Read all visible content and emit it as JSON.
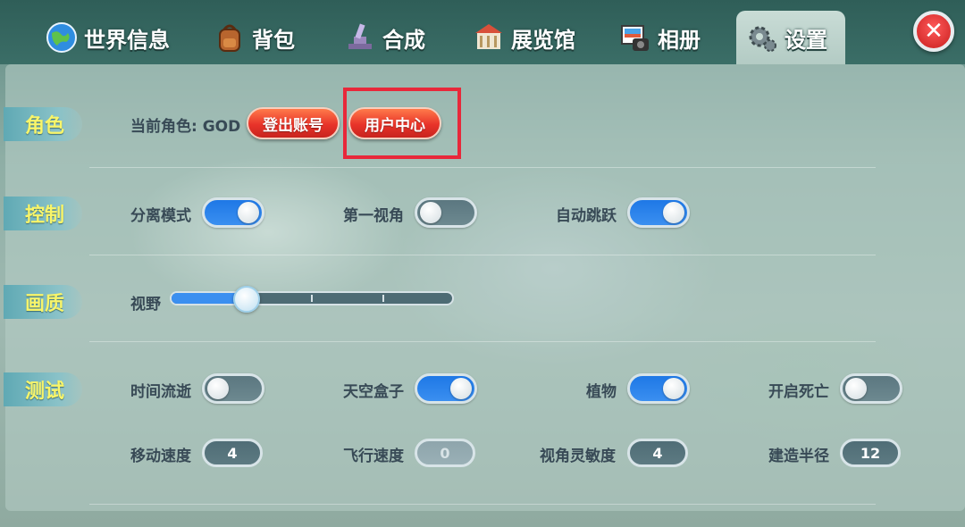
{
  "tabs": [
    {
      "label": "世界信息",
      "icon": "globe-icon"
    },
    {
      "label": "背包",
      "icon": "backpack-icon"
    },
    {
      "label": "合成",
      "icon": "anvil-icon"
    },
    {
      "label": "展览馆",
      "icon": "museum-icon"
    },
    {
      "label": "相册",
      "icon": "camera-photo-icon"
    },
    {
      "label": "设置",
      "icon": "gear-icon",
      "active": true
    }
  ],
  "close": {
    "glyph": "✕"
  },
  "role": {
    "section": "角色",
    "current": "当前角色: GOD",
    "logout_label": "登出账号",
    "user_center_label": "用户中心"
  },
  "control": {
    "section": "控制",
    "separate_mode": {
      "label": "分离模式",
      "on": true
    },
    "first_person": {
      "label": "第一视角",
      "on": false
    },
    "auto_jump": {
      "label": "自动跳跃",
      "on": true
    }
  },
  "quality": {
    "section": "画质",
    "fov": {
      "label": "视野",
      "value_fraction": 0.27
    }
  },
  "test": {
    "section": "测试",
    "time_flow": {
      "label": "时间流逝",
      "on": false
    },
    "skybox": {
      "label": "天空盒子",
      "on": true
    },
    "plants": {
      "label": "植物",
      "on": true
    },
    "death": {
      "label": "开启死亡",
      "on": false
    },
    "move_speed": {
      "label": "移动速度",
      "value": "4"
    },
    "fly_speed": {
      "label": "飞行速度",
      "value": "0"
    },
    "view_sensitivity": {
      "label": "视角灵敏度",
      "value": "4"
    },
    "build_radius": {
      "label": "建造半径",
      "value": "12"
    }
  },
  "colors": {
    "accent_blue": "#1e78e6",
    "button_red": "#e8332a",
    "section_label": "#f8f56a"
  }
}
